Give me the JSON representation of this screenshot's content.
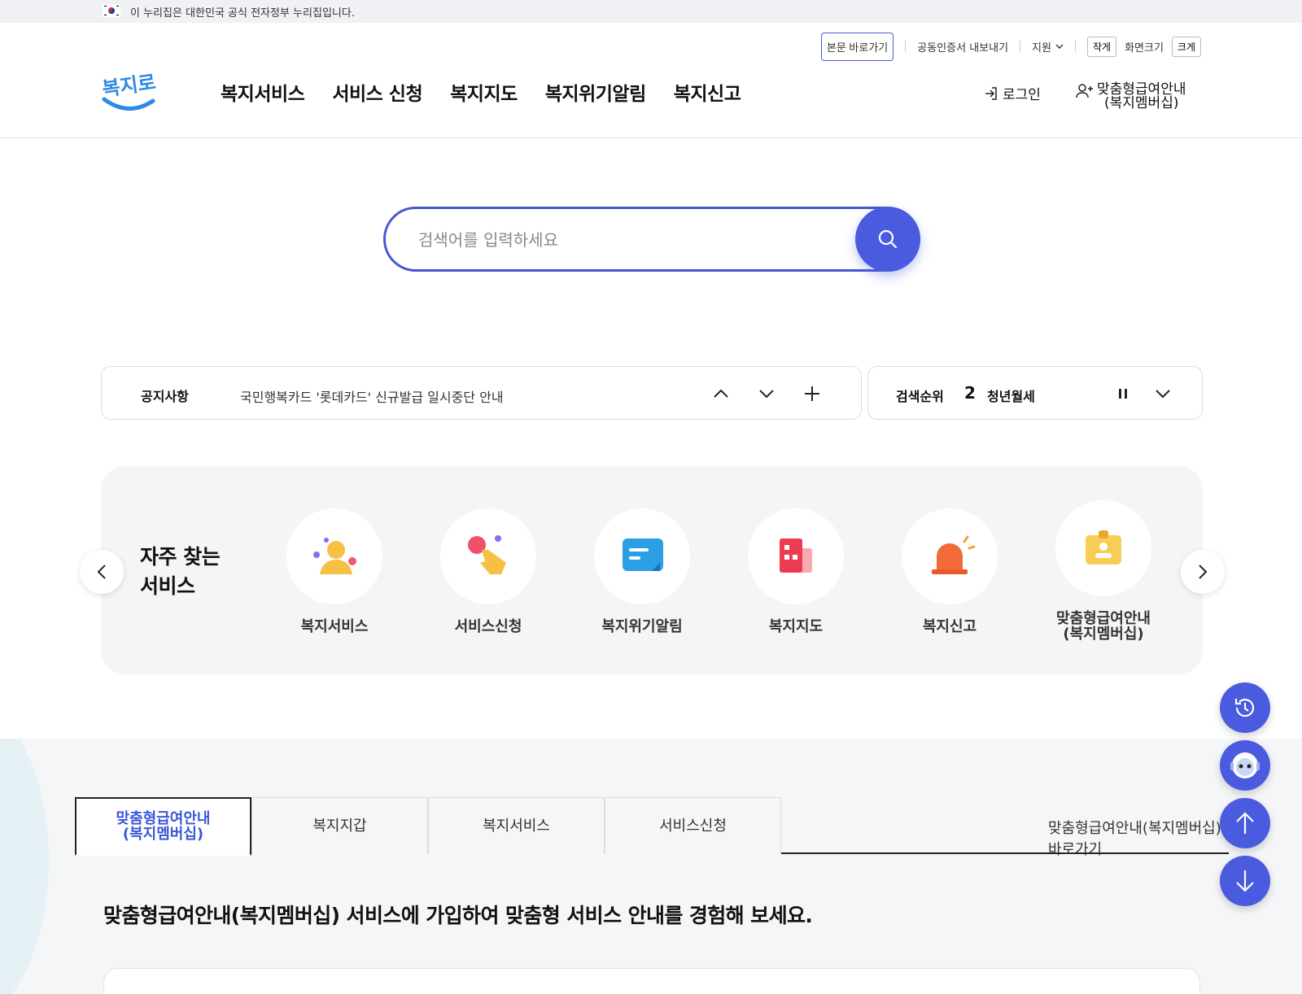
{
  "gov_banner": {
    "text": "이 누리집은 대한민국 공식 전자정부 누리집입니다."
  },
  "utility": {
    "skip_to_content": "본문 바로가기",
    "cert_export": "공동인증서 내보내기",
    "support": "지원",
    "font_small": "작게",
    "screen_size": "화면크기",
    "font_large": "크게"
  },
  "brand": {
    "logo_text": "복지로",
    "accent": "#4b5be0"
  },
  "gnb": {
    "items": [
      {
        "label": "복지서비스"
      },
      {
        "label": "서비스 신청"
      },
      {
        "label": "복지지도"
      },
      {
        "label": "복지위기알림"
      },
      {
        "label": "복지신고"
      }
    ]
  },
  "account": {
    "login": "로그인",
    "membership_line1": "맞춤형급여안내",
    "membership_line2": "(복지멤버십)"
  },
  "search": {
    "placeholder": "검색어를 입력하세요",
    "value": ""
  },
  "notice": {
    "label": "공지사항",
    "text": "국민행복카드 '롯데카드' 신규발급 일시중단 안내"
  },
  "ranking": {
    "label": "검색순위",
    "rank": "2",
    "keyword": "청년월세"
  },
  "frequent": {
    "title_line1": "자주 찾는",
    "title_line2": "서비스",
    "items": [
      {
        "label": "복지서비스",
        "icon": "person-icon"
      },
      {
        "label": "서비스신청",
        "icon": "hand-tap-icon"
      },
      {
        "label": "복지위기알림",
        "icon": "message-icon"
      },
      {
        "label": "복지지도",
        "icon": "map-building-icon"
      },
      {
        "label": "복지신고",
        "icon": "siren-icon"
      },
      {
        "label_line1": "맞춤형급여안내",
        "label_line2": "(복지멤버십)",
        "icon": "id-card-icon"
      }
    ]
  },
  "tabs": {
    "items": [
      {
        "label_line1": "맞춤형급여안내",
        "label_line2": "(복지멤버십)",
        "active": true
      },
      {
        "label": "복지지갑",
        "active": false
      },
      {
        "label": "복지서비스",
        "active": false
      },
      {
        "label": "서비스신청",
        "active": false
      }
    ],
    "shortcut": "맞춤형급여안내(복지멤버십) 바로가기"
  },
  "promo": {
    "text": "맞춤형급여안내(복지멤버십) 서비스에 가입하여 맞춤형 서비스 안내를 경험해 보세요."
  },
  "floating": [
    {
      "icon": "history-icon"
    },
    {
      "icon": "chatbot-icon"
    },
    {
      "icon": "arrow-up-icon"
    },
    {
      "icon": "arrow-down-icon"
    }
  ]
}
